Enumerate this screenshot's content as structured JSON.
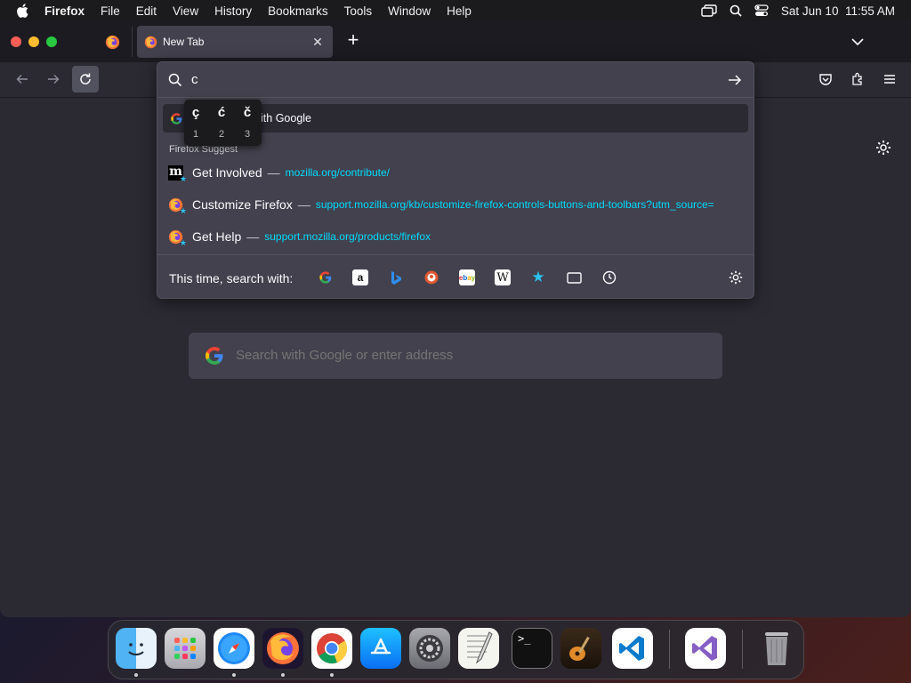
{
  "menubar": {
    "app_name": "Firefox",
    "menus": [
      "File",
      "Edit",
      "View",
      "History",
      "Bookmarks",
      "Tools",
      "Window",
      "Help"
    ],
    "clock": "Sat Jun 10  11:55 AM"
  },
  "tabs": {
    "active_title": "New Tab"
  },
  "urlbar": {
    "typed_text": "c",
    "google_row": "Search with Google",
    "google_row_visible": "with Google",
    "suggest_header": "Firefox Suggest",
    "suggestions": [
      {
        "title": "Get Involved",
        "url": "mozilla.org/contribute/"
      },
      {
        "title": "Customize Firefox",
        "url": "support.mozilla.org/kb/customize-firefox-controls-buttons-and-toolbars?utm_source="
      },
      {
        "title": "Get Help",
        "url": "support.mozilla.org/products/firefox"
      }
    ],
    "search_with_label": "This time, search with:",
    "engines": [
      "google-icon",
      "amazon-icon",
      "bing-icon",
      "duckduckgo-icon",
      "ebay-icon",
      "wikipedia-icon",
      "bookmarks-icon",
      "tabs-icon",
      "history-icon"
    ]
  },
  "accent_picker": {
    "chars": [
      "ç",
      "ć",
      "č"
    ],
    "numbers": [
      "1",
      "2",
      "3"
    ]
  },
  "main_search": {
    "placeholder": "Search with Google or enter address"
  },
  "colors": {
    "accent_link": "#00ddff",
    "tab_active": "#42414d",
    "page_bg": "#2b2a33"
  },
  "dock": [
    "Finder",
    "Launchpad",
    "Safari",
    "Firefox",
    "Chrome",
    "App Store",
    "System Settings",
    "TextEdit",
    "Terminal",
    "GarageBand",
    "Visual Studio Code",
    "Visual Studio",
    "Trash"
  ]
}
